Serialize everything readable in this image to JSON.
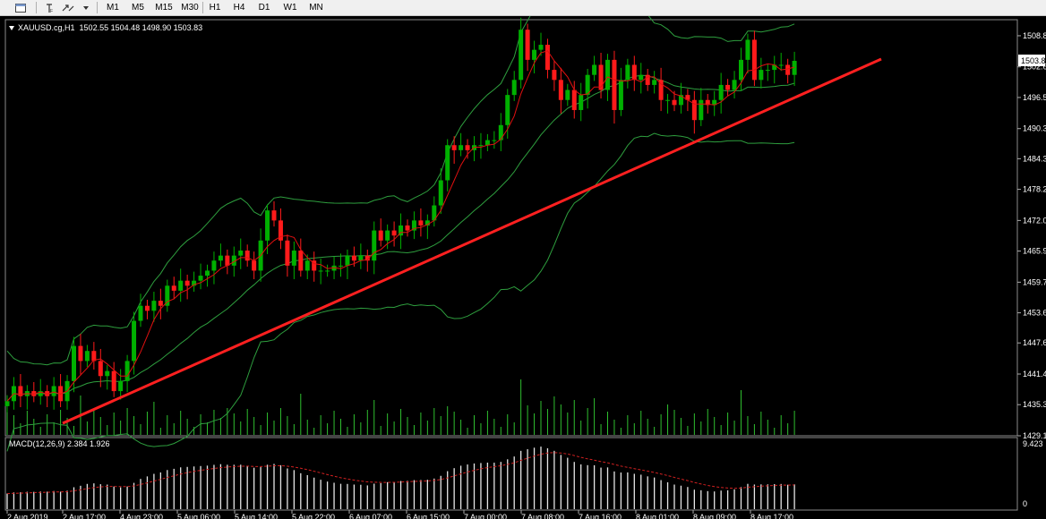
{
  "toolbar": {
    "icons": [
      "chart-window-icon",
      "crosshair-icon",
      "text-icon",
      "fibonacci-icon",
      "arrow-icon"
    ],
    "timeframes": [
      "M1",
      "M5",
      "M15",
      "M30",
      "H1",
      "H4",
      "D1",
      "W1",
      "MN"
    ]
  },
  "header": {
    "symbol": "XAUUSD.cg,H1",
    "ohlc": "1502.55 1504.48 1498.90 1503.83"
  },
  "macd_header": {
    "label": "MACD(12,26,9) 2.384 1.926"
  },
  "colors": {
    "background": "#000000",
    "bull_candle": "#00b000",
    "bear_candle": "#ff1a1a",
    "bollinger": "#2e9e3e",
    "ma": "#e01010",
    "trendline": "#ff2020",
    "volume": "#2fbf2f",
    "macd_hist": "#e6e6e6",
    "macd_signal": "#d02020",
    "axis_text": "#ffffff"
  },
  "chart_data": [
    {
      "type": "candlestick",
      "title": "XAUUSD.cg,H1",
      "ylim": [
        1429.1,
        1512.0
      ],
      "yticks": [
        "1508.8",
        "1502.6",
        "1496.5",
        "1490.3",
        "1484.3",
        "1478.2",
        "1472.0",
        "1465.9",
        "1459.7",
        "1453.6",
        "1447.6",
        "1441.4",
        "1435.3",
        "1429.1"
      ],
      "current_price_label": "1503.8",
      "xticks": [
        "2 Aug 2019",
        "2 Aug 17:00",
        "4 Aug 23:00",
        "5 Aug 06:00",
        "5 Aug 14:00",
        "5 Aug 22:00",
        "6 Aug 07:00",
        "6 Aug 15:00",
        "7 Aug 00:00",
        "7 Aug 08:00",
        "7 Aug 16:00",
        "8 Aug 01:00",
        "8 Aug 09:00",
        "8 Aug 17:00"
      ],
      "closes": [
        1436,
        1439,
        1437,
        1438,
        1437,
        1438,
        1437,
        1439,
        1436,
        1440,
        1447,
        1444,
        1446,
        1444,
        1441,
        1442,
        1438,
        1440,
        1444,
        1452,
        1455,
        1454,
        1456,
        1455,
        1459,
        1458,
        1460,
        1459,
        1460,
        1461,
        1462,
        1464,
        1465,
        1463,
        1465,
        1466,
        1464,
        1462,
        1468,
        1474,
        1472,
        1468,
        1463,
        1466,
        1462,
        1464,
        1462,
        1462,
        1462,
        1463,
        1463,
        1465,
        1464,
        1465,
        1464,
        1470,
        1468,
        1470,
        1469,
        1471,
        1470,
        1472,
        1471,
        1472,
        1475,
        1480,
        1487,
        1486,
        1487,
        1486,
        1487,
        1487,
        1488,
        1488,
        1491,
        1497,
        1500,
        1510,
        1504,
        1506,
        1507,
        1502,
        1500,
        1496,
        1498,
        1494,
        1497,
        1501,
        1503,
        1498,
        1504,
        1494,
        1500,
        1503,
        1500,
        1501,
        1499,
        1500,
        1496,
        1496,
        1495,
        1497,
        1496,
        1492,
        1496,
        1495,
        1496,
        1499,
        1498,
        1500,
        1504,
        1508,
        1500,
        1502,
        1502,
        1503,
        1503,
        1501,
        1503.8
      ],
      "volume_note": "volume histogram along bottom of price panel",
      "indicators": [
        "Bollinger Bands",
        "Moving Average",
        "Trendline"
      ]
    },
    {
      "type": "bar",
      "title": "MACD(12,26,9) 2.384 1.926",
      "ylim": [
        0,
        9.423
      ],
      "yticks": [
        "9.423",
        "0"
      ],
      "macd_value": 2.384,
      "signal_value": 1.926
    }
  ]
}
